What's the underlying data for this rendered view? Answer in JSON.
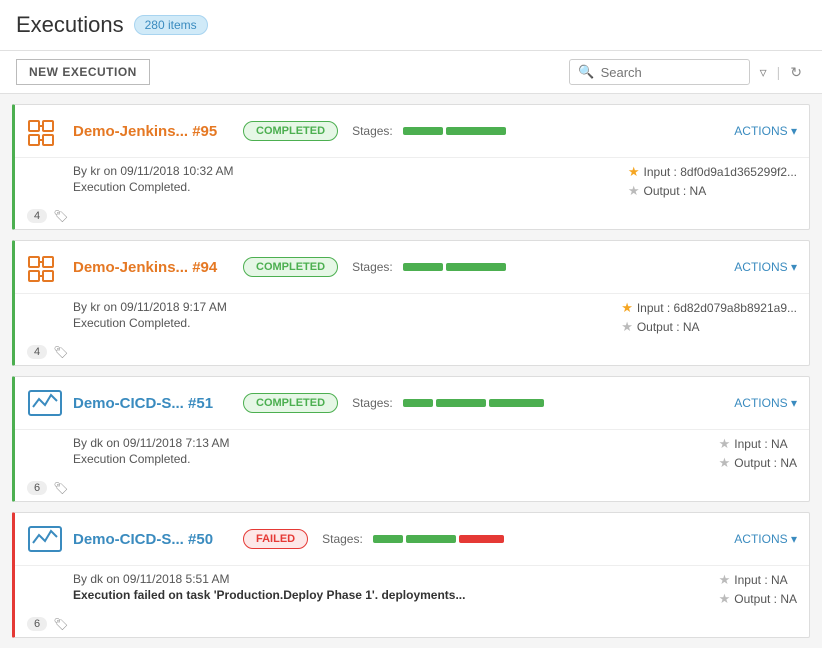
{
  "header": {
    "title": "Executions",
    "items_count": "280 items"
  },
  "toolbar": {
    "new_execution_label": "NEW EXECUTION",
    "search_placeholder": "Search"
  },
  "executions": [
    {
      "id": "exec-95",
      "name": "Demo-Jenkins... #95",
      "type": "jenkins",
      "status": "COMPLETED",
      "by": "By kr on 09/11/2018 10:32 AM",
      "message": "Execution Completed.",
      "tags": "4",
      "input": "Input : 8df0d9a1d365299f2...",
      "output": "Output : NA",
      "input_starred": true,
      "output_starred": false,
      "stages": [
        {
          "width": 40,
          "type": "green"
        },
        {
          "width": 60,
          "type": "green"
        }
      ]
    },
    {
      "id": "exec-94",
      "name": "Demo-Jenkins... #94",
      "type": "jenkins",
      "status": "COMPLETED",
      "by": "By kr on 09/11/2018 9:17 AM",
      "message": "Execution Completed.",
      "tags": "4",
      "input": "Input : 6d82d079a8b8921a9...",
      "output": "Output : NA",
      "input_starred": true,
      "output_starred": false,
      "stages": [
        {
          "width": 40,
          "type": "green"
        },
        {
          "width": 60,
          "type": "green"
        }
      ]
    },
    {
      "id": "exec-51",
      "name": "Demo-CICD-S... #51",
      "type": "cicd",
      "status": "COMPLETED",
      "by": "By dk on 09/11/2018 7:13 AM",
      "message": "Execution Completed.",
      "tags": "6",
      "input": "Input : NA",
      "output": "Output : NA",
      "input_starred": false,
      "output_starred": false,
      "stages": [
        {
          "width": 30,
          "type": "green"
        },
        {
          "width": 50,
          "type": "green"
        },
        {
          "width": 55,
          "type": "green"
        }
      ]
    },
    {
      "id": "exec-50",
      "name": "Demo-CICD-S... #50",
      "type": "cicd",
      "status": "FAILED",
      "by": "By dk on 09/11/2018 5:51 AM",
      "message": "Execution failed on task 'Production.Deploy Phase 1'. deployments...",
      "tags": "6",
      "input": "Input : NA",
      "output": "Output : NA",
      "input_starred": false,
      "output_starred": false,
      "stages": [
        {
          "width": 30,
          "type": "green"
        },
        {
          "width": 50,
          "type": "green"
        },
        {
          "width": 45,
          "type": "red"
        }
      ]
    }
  ],
  "actions_label": "ACTIONS",
  "chevron": "▾"
}
